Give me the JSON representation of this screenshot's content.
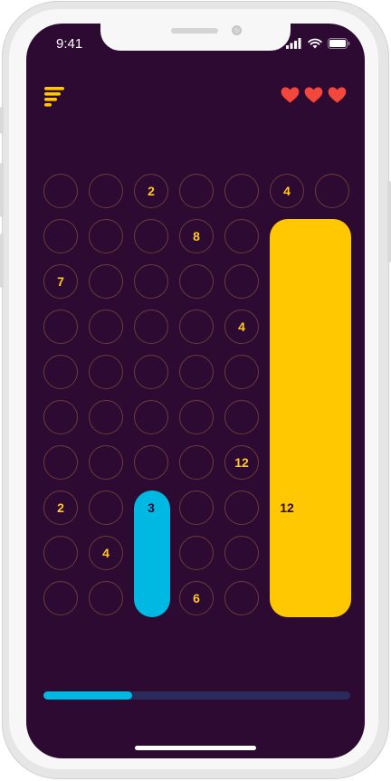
{
  "status_bar": {
    "time": "9:41"
  },
  "header": {
    "menu_icon": "menu-icon",
    "lives": 3,
    "max_lives": 3,
    "heart_color": "#f4473c"
  },
  "colors": {
    "background": "#2c0a31",
    "cell_border": "#6b3c3a",
    "number": "#ffc728",
    "blue": "#00b9e3",
    "yellow": "#ffc800"
  },
  "board": {
    "rows": 10,
    "cols": 7,
    "numbers": [
      {
        "row": 0,
        "col": 2,
        "value": "2"
      },
      {
        "row": 0,
        "col": 5,
        "value": "4"
      },
      {
        "row": 1,
        "col": 3,
        "value": "8"
      },
      {
        "row": 2,
        "col": 0,
        "value": "7"
      },
      {
        "row": 3,
        "col": 4,
        "value": "4"
      },
      {
        "row": 6,
        "col": 4,
        "value": "12"
      },
      {
        "row": 7,
        "col": 0,
        "value": "2"
      },
      {
        "row": 8,
        "col": 1,
        "value": "4"
      },
      {
        "row": 9,
        "col": 3,
        "value": "6"
      }
    ],
    "pieces": [
      {
        "id": "blue",
        "color": "blue",
        "col": 2,
        "col_span": 1,
        "row": 7,
        "row_span": 3,
        "value": "3",
        "label_row": 7,
        "label_col": 2
      },
      {
        "id": "yellow",
        "color": "yellow",
        "col": 5,
        "col_span": 2,
        "row": 1,
        "row_span": 9,
        "value": "12",
        "label_row": 7,
        "label_col": 5
      }
    ]
  },
  "progress": {
    "value": 0.29
  }
}
